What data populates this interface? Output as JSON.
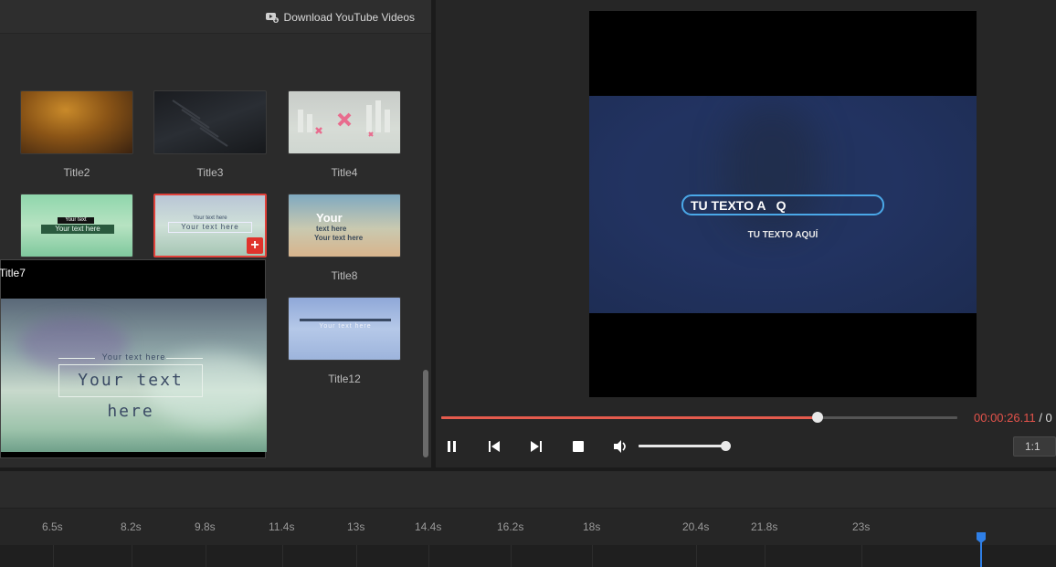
{
  "library": {
    "download_label": "Download YouTube Videos",
    "items": [
      {
        "label": "Title2"
      },
      {
        "label": "Title3"
      },
      {
        "label": "Title4"
      },
      {
        "label": "",
        "thumb_small": "Your text",
        "thumb_big": "Your text here"
      },
      {
        "label": "",
        "thumb_small": "Your text here",
        "thumb_big": "Your text here",
        "selected": true
      },
      {
        "label": "Title8",
        "thumb_big": "Your",
        "thumb_mid": "text here",
        "thumb_sub": "Your text here"
      },
      {
        "label": "Title12",
        "thumb_big": "Your text here"
      }
    ],
    "add_symbol": "+"
  },
  "preview": {
    "title": "Title7",
    "small_text": "Your text here",
    "big_text": "Your text here"
  },
  "player": {
    "overlay_title": "TU TEXTO A   Q",
    "overlay_subtitle": "TU TEXTO AQUÍ",
    "time_current": "00:00:26.11",
    "time_separator": " / 0",
    "progress_fraction": 0.73,
    "volume_fraction": 1.0,
    "aspect_ratio_label": "1:1",
    "controls": [
      "pause-icon",
      "previous-frame-icon",
      "next-frame-icon",
      "stop-icon",
      "volume-icon"
    ]
  },
  "timeline": {
    "ticks": [
      "6.5s",
      "8.2s",
      "9.8s",
      "11.4s",
      "13s",
      "14.4s",
      "16.2s",
      "18s",
      "20.4s",
      "21.8s",
      "23s"
    ],
    "playhead_color": "#2f7fe6"
  },
  "colors": {
    "accent": "#e55b4d",
    "selection": "#e0413a",
    "title_box_border": "#4aa8e8"
  }
}
